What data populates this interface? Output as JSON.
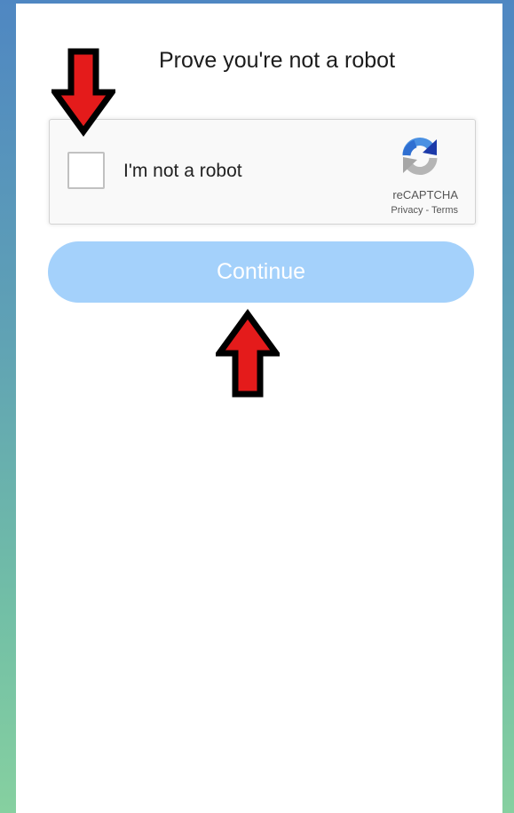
{
  "page": {
    "title": "Prove you're not a robot"
  },
  "captcha": {
    "label": "I'm not a robot",
    "brand": "reCAPTCHA",
    "privacy_link": "Privacy",
    "separator": " - ",
    "terms_link": "Terms",
    "checked": false
  },
  "continue_button": {
    "label": "Continue"
  },
  "icons": {
    "recaptcha": "recaptcha-logo-icon",
    "down_arrow": "red-down-arrow-icon",
    "up_arrow": "red-up-arrow-icon"
  },
  "colors": {
    "button_bg": "#a4d1fb",
    "arrow_fill": "#e41b1b",
    "arrow_outline": "#000000"
  }
}
